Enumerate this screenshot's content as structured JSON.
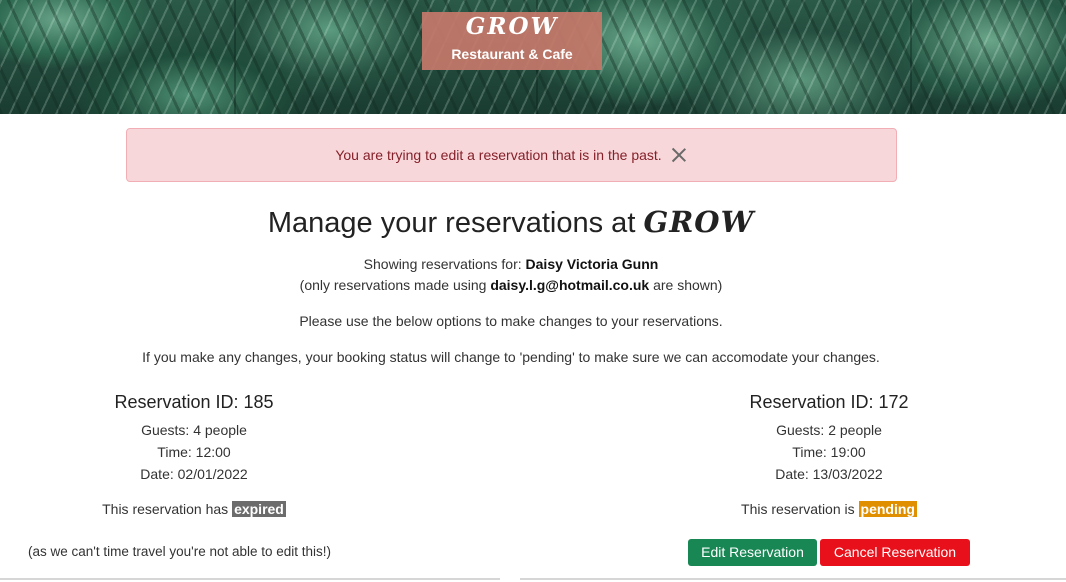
{
  "header": {
    "brand": "GROW",
    "subtitle": "Restaurant & Cafe"
  },
  "alert": {
    "message": "You are trying to edit a reservation that is in the past.",
    "close_icon": "close-icon"
  },
  "main": {
    "title_prefix": "Manage your reservations at",
    "title_brand": "GROW",
    "showing_prefix": "Showing reservations for:",
    "customer_name": "Daisy Victoria Gunn",
    "only_prefix": "(only reservations made using",
    "email": "daisy.l.g@hotmail.co.uk",
    "only_suffix": "are shown)",
    "instructions": "Please use the below options to make changes to your reservations.",
    "pending_note": "If you make any changes, your booking status will change to 'pending' to make sure we can accomodate your changes."
  },
  "reservations": [
    {
      "id_label": "Reservation ID: 185",
      "guests": "Guests: 4 people",
      "time": "Time: 12:00",
      "date": "Date: 02/01/2022",
      "status_prefix": "This reservation has",
      "status": "expired",
      "note": "(as we can't time travel you're not able to edit this!)"
    },
    {
      "id_label": "Reservation ID: 172",
      "guests": "Guests: 2 people",
      "time": "Time: 19:00",
      "date": "Date: 13/03/2022",
      "status_prefix": "This reservation is",
      "status": "pending",
      "edit_label": "Edit Reservation",
      "cancel_label": "Cancel Reservation"
    }
  ],
  "colors": {
    "alert_bg": "#f8d7da",
    "expired_badge": "#6c6c6c",
    "pending_badge": "#e08f00",
    "edit_button": "#198754",
    "cancel_button": "#e8101a",
    "logo_bg": "#c6786a"
  }
}
